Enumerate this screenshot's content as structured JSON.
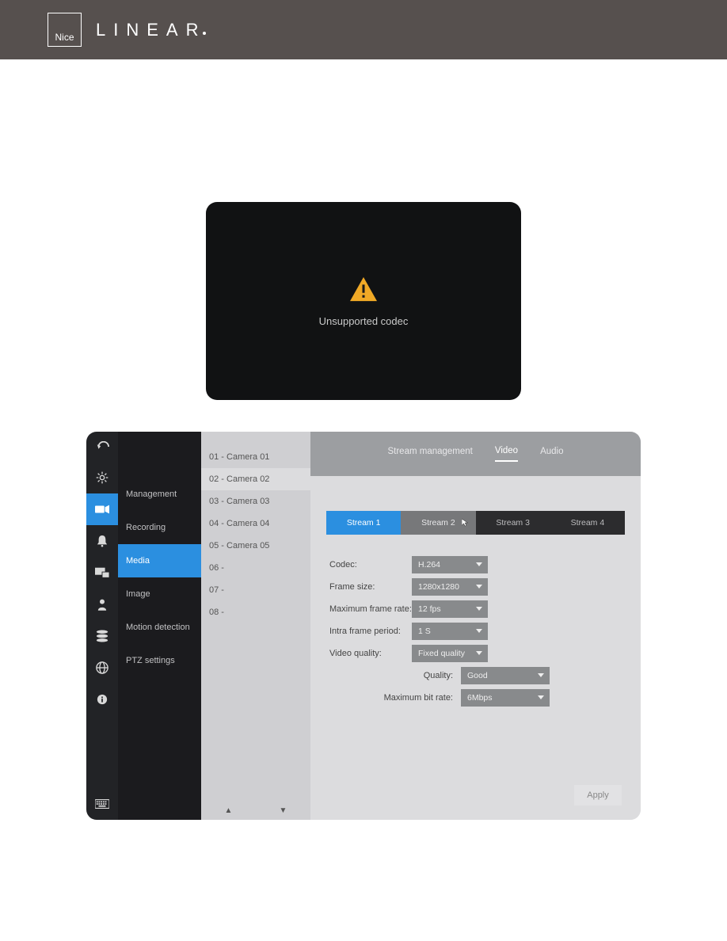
{
  "header": {
    "nice": "Nice",
    "linear": "LINEAR"
  },
  "video_panel": {
    "message": "Unsupported codec"
  },
  "top_tabs": {
    "a": "Stream management",
    "b": "Video",
    "c": "Audio"
  },
  "nav": {
    "management": "Management",
    "recording": "Recording",
    "media": "Media",
    "image": "Image",
    "motion": "Motion detection",
    "ptz": "PTZ settings"
  },
  "cameras": {
    "c1": "01 - Camera 01",
    "c2": "02 - Camera 02",
    "c3": "03 - Camera 03",
    "c4": "04 - Camera 04",
    "c5": "05 - Camera 05",
    "c6": "06 -",
    "c7": "07 -",
    "c8": "08 -"
  },
  "streams": {
    "s1": "Stream 1",
    "s2": "Stream 2",
    "s3": "Stream 3",
    "s4": "Stream 4"
  },
  "form": {
    "codec_l": "Codec:",
    "codec_v": "H.264",
    "fsize_l": "Frame size:",
    "fsize_v": "1280x1280",
    "mfr_l": "Maximum frame rate:",
    "mfr_v": "12 fps",
    "ifp_l": "Intra frame period:",
    "ifp_v": "1 S",
    "vq_l": "Video quality:",
    "vq_v": "Fixed quality",
    "q_l": "Quality:",
    "q_v": "Good",
    "mbr_l": "Maximum bit rate:",
    "mbr_v": "6Mbps"
  },
  "apply": "Apply"
}
